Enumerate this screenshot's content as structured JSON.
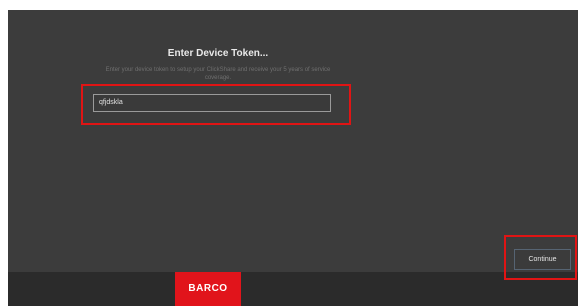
{
  "dialog": {
    "title": "Enter Device Token...",
    "description": "Enter your device token to setup your ClickShare and receive your 5 years of service coverage."
  },
  "token_input": {
    "value": "qfjdskla"
  },
  "buttons": {
    "continue_label": "Continue"
  },
  "footer": {
    "brand": "BARCO"
  },
  "colors": {
    "highlight": "#e01414",
    "brand": "#e1141b",
    "background": "#3c3c3c"
  }
}
